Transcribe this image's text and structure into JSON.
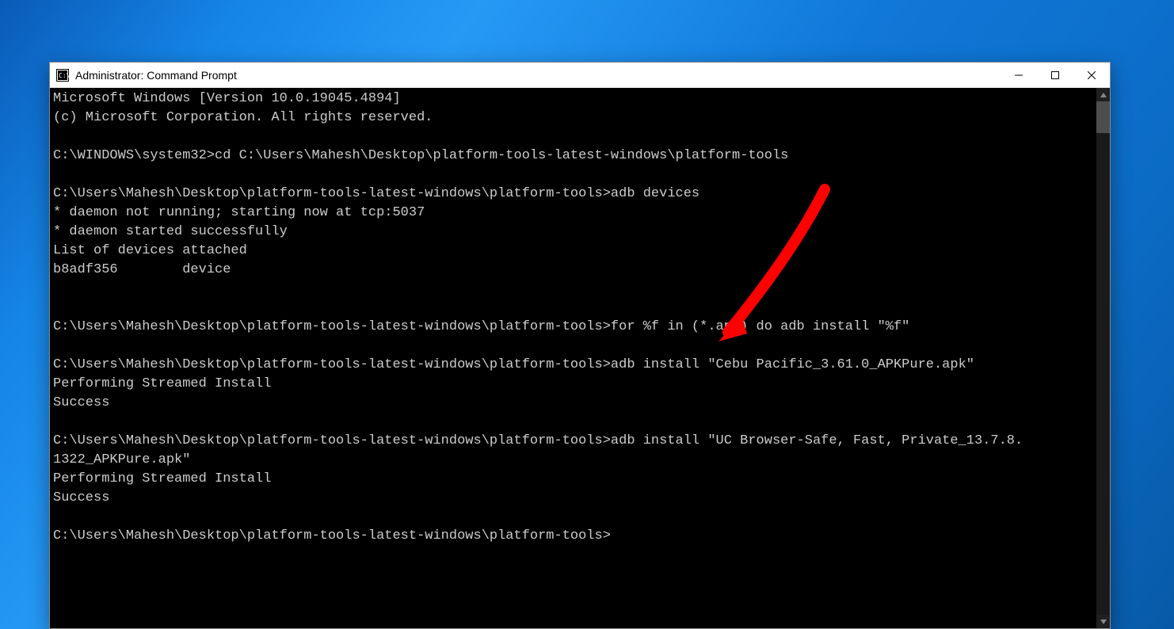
{
  "window": {
    "title": "Administrator: Command Prompt"
  },
  "terminal": {
    "lines": [
      "Microsoft Windows [Version 10.0.19045.4894]",
      "(c) Microsoft Corporation. All rights reserved.",
      "",
      "C:\\WINDOWS\\system32>cd C:\\Users\\Mahesh\\Desktop\\platform-tools-latest-windows\\platform-tools",
      "",
      "C:\\Users\\Mahesh\\Desktop\\platform-tools-latest-windows\\platform-tools>adb devices",
      "* daemon not running; starting now at tcp:5037",
      "* daemon started successfully",
      "List of devices attached",
      "b8adf356        device",
      "",
      "",
      "C:\\Users\\Mahesh\\Desktop\\platform-tools-latest-windows\\platform-tools>for %f in (*.apk) do adb install \"%f\"",
      "",
      "C:\\Users\\Mahesh\\Desktop\\platform-tools-latest-windows\\platform-tools>adb install \"Cebu Pacific_3.61.0_APKPure.apk\"",
      "Performing Streamed Install",
      "Success",
      "",
      "C:\\Users\\Mahesh\\Desktop\\platform-tools-latest-windows\\platform-tools>adb install \"UC Browser-Safe, Fast, Private_13.7.8.",
      "1322_APKPure.apk\"",
      "Performing Streamed Install",
      "Success",
      "",
      "C:\\Users\\Mahesh\\Desktop\\platform-tools-latest-windows\\platform-tools>"
    ]
  },
  "annotation": {
    "arrow_color": "#ff0000"
  }
}
